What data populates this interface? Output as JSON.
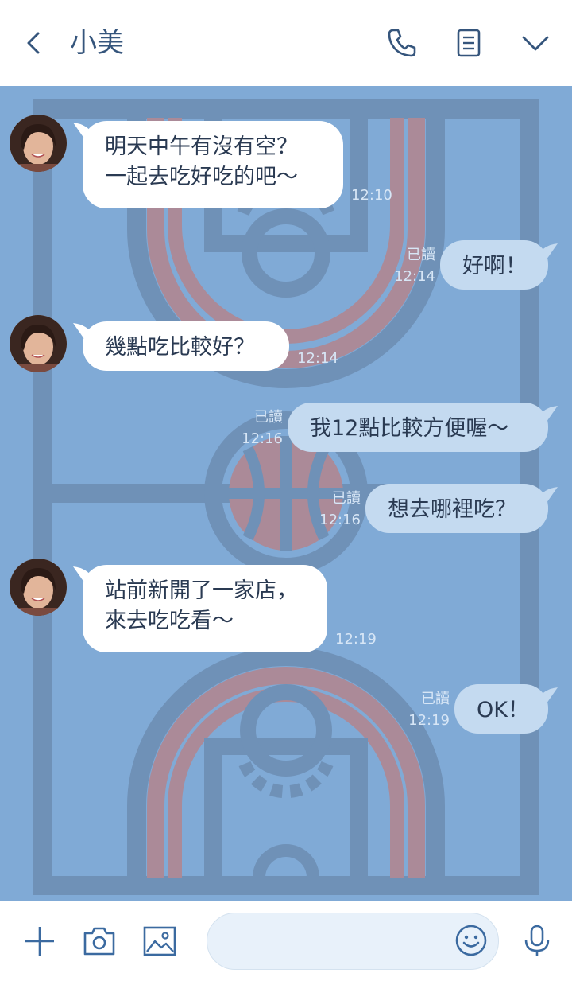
{
  "header": {
    "title": "小美",
    "back_icon": "chevron-left-icon",
    "call_icon": "phone-icon",
    "notes_icon": "notes-icon",
    "menu_icon": "chevron-down-icon"
  },
  "colors": {
    "chat_background": "#80aad6",
    "incoming_bubble": "#ffffff",
    "outgoing_bubble": "#c4daf0",
    "court_lines": "#6f91b7",
    "court_key": "#ab8a98",
    "accent": "#3b6aa0"
  },
  "messages": [
    {
      "side": "left",
      "lines": [
        "明天中午有沒有空？",
        "一起去吃好吃的吧～"
      ],
      "time": "12:10"
    },
    {
      "side": "right",
      "text": "好啊！",
      "read": "已讀",
      "time": "12:14"
    },
    {
      "side": "left",
      "lines": [
        "幾點吃比較好？"
      ],
      "time": "12:14"
    },
    {
      "side": "right",
      "text": "我12點比較方便喔～",
      "read": "已讀",
      "time": "12:16"
    },
    {
      "side": "right",
      "text": "想去哪裡吃？",
      "read": "已讀",
      "time": "12:16"
    },
    {
      "side": "left",
      "lines": [
        "站前新開了一家店，",
        "來去吃吃看～"
      ],
      "time": "12:19"
    },
    {
      "side": "right",
      "text": "OK！",
      "read": "已讀",
      "time": "12:19"
    }
  ],
  "bottom_bar": {
    "add_icon": "plus-icon",
    "camera_icon": "camera-icon",
    "image_icon": "image-icon",
    "input_placeholder": "",
    "emoji_icon": "emoji-icon",
    "mic_icon": "microphone-icon"
  }
}
